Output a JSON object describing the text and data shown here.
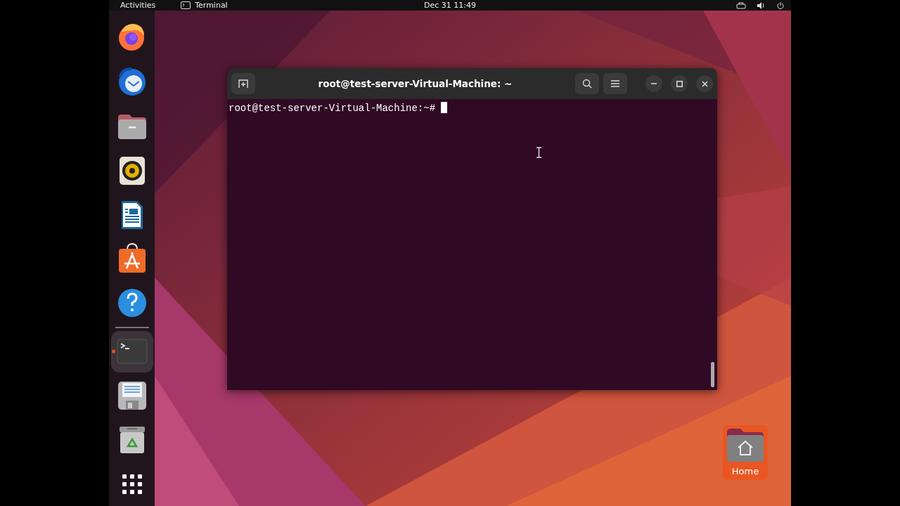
{
  "top_bar": {
    "activities": "Activities",
    "app": "Terminal",
    "clock": "Dec 31  11:49"
  },
  "dock": {
    "items": [
      {
        "kind": "browser",
        "running": false
      },
      {
        "kind": "mail",
        "running": false
      },
      {
        "kind": "files",
        "running": false
      },
      {
        "kind": "music",
        "running": false
      },
      {
        "kind": "writer",
        "running": false
      },
      {
        "kind": "store",
        "running": false
      },
      {
        "kind": "help",
        "running": false
      },
      {
        "kind": "separator"
      },
      {
        "kind": "terminal",
        "running": true
      },
      {
        "kind": "disk",
        "running": false
      },
      {
        "kind": "trash",
        "running": false
      },
      {
        "kind": "apps",
        "running": false
      }
    ]
  },
  "terminal": {
    "title": "root@test-server-Virtual-Machine: ~",
    "prompt": "root@test-server-Virtual-Machine:~#"
  },
  "desktop_icons": [
    {
      "label": "Home",
      "selected": true
    }
  ]
}
